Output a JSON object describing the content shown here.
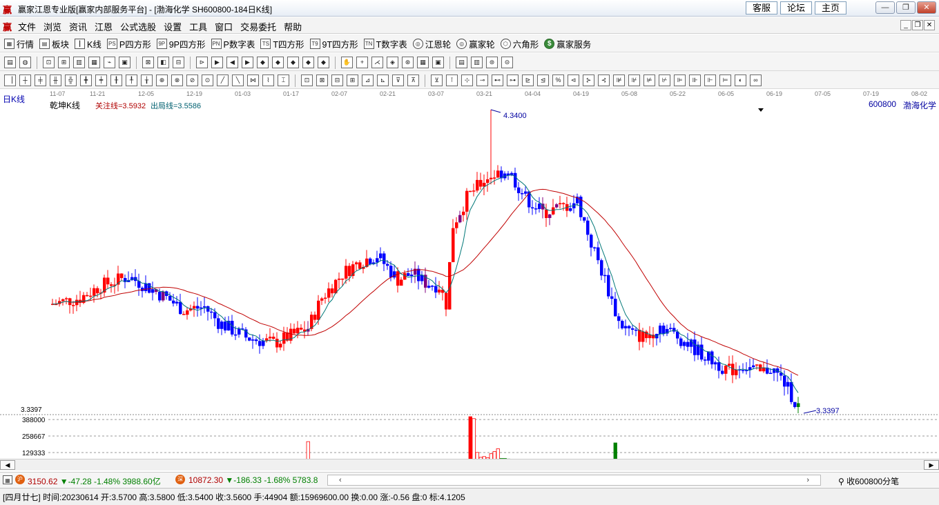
{
  "window": {
    "title": "赢家江恩专业版[赢家内部服务平台] - [渤海化学   SH600800-184日K线]",
    "links": [
      "客服",
      "论坛",
      "主页"
    ]
  },
  "menu": [
    "文件",
    "浏览",
    "资讯",
    "江恩",
    "公式选股",
    "设置",
    "工具",
    "窗口",
    "交易委托",
    "帮助"
  ],
  "toolbar1": [
    {
      "icon": "grid-icon",
      "label": "行情"
    },
    {
      "icon": "blocks-icon",
      "label": "板块"
    },
    {
      "icon": "kline-icon",
      "label": "K线"
    },
    {
      "icon": "ps-icon",
      "glyph": "PS",
      "label": "P四方形"
    },
    {
      "icon": "9p-icon",
      "glyph": "9P",
      "label": "9P四方形"
    },
    {
      "icon": "pn-icon",
      "glyph": "PN",
      "label": "P数字表"
    },
    {
      "icon": "ts-icon",
      "glyph": "TS",
      "label": "T四方形"
    },
    {
      "icon": "9t-icon",
      "glyph": "T9",
      "label": "9T四方形"
    },
    {
      "icon": "tn-icon",
      "glyph": "TN",
      "label": "T数字表"
    },
    {
      "icon": "gann-wheel-icon",
      "label": "江恩轮"
    },
    {
      "icon": "winner-wheel-icon",
      "label": "赢家轮"
    },
    {
      "icon": "hexagon-icon",
      "label": "六角形"
    },
    {
      "icon": "dollar-icon",
      "glyph": "$",
      "label": "赢家服务"
    }
  ],
  "chart_header": {
    "period_label": "日K线",
    "chart_name": "乾坤K线",
    "focus_line": "关注线=3.5932",
    "exit_line": "出局线=3.5586",
    "stock_code": "600800",
    "stock_name": "渤海化学"
  },
  "chart_data": {
    "type": "candlestick",
    "x_tick_labels": [
      "11-07",
      "11-21",
      "12-05",
      "12-19",
      "01-03",
      "01-17",
      "02-07",
      "02-21",
      "03-07",
      "03-21",
      "04-04",
      "04-19",
      "05-08",
      "05-22",
      "06-05",
      "06-19",
      "07-05",
      "07-19",
      "08-02"
    ],
    "annotations": {
      "high_label": "4.3400",
      "low_label": "3.3397",
      "price_axis_label": "3.3397"
    },
    "volume_axis_labels": [
      "388000",
      "258667",
      "129333"
    ],
    "colors": {
      "up": "#ff0000",
      "down": "#0000ff",
      "neutral": "#800080",
      "ma_long": "#c00000",
      "ma_short": "#007878",
      "vol_up": "#ff0000",
      "vol_down": "#008000"
    }
  },
  "index_bar": {
    "sh_value": "3150.62",
    "sh_change": "▼-47.28 -1.48% 3988.60亿",
    "sz_value": "10872.30",
    "sz_change": "▼-186.33 -1.68% 5783.8",
    "receive": "收600800分笔"
  },
  "status": {
    "text": "[四月廿七] 时间:20230614 开:3.5700 高:3.5800 低:3.5400 收:3.5600 手:44904 额:15969600.00 换:0.00 涨:-0.56 盘:0 标:4.1205"
  }
}
